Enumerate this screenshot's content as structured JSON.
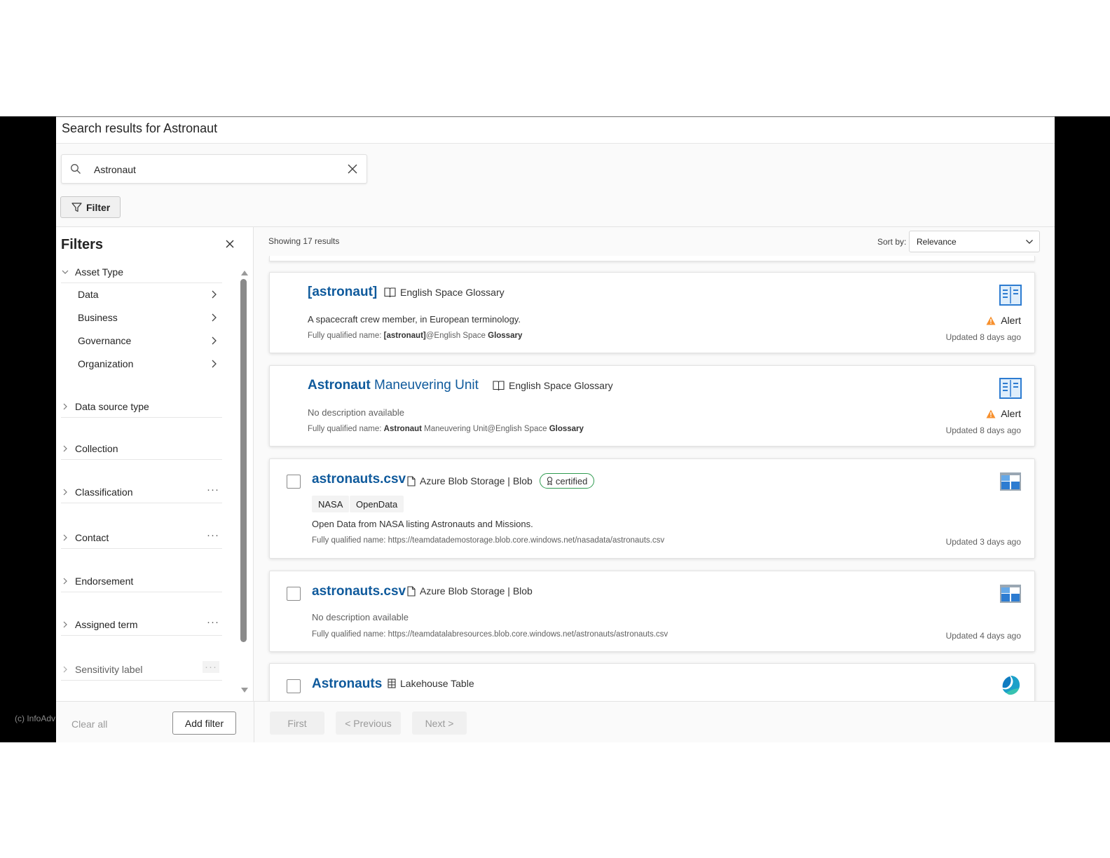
{
  "watermark": "(c) InfoAdv",
  "page": {
    "title": "Search results for Astronaut"
  },
  "search": {
    "value": "Astronaut",
    "placeholder": "Search"
  },
  "filter_button": {
    "label": "Filter"
  },
  "filters": {
    "heading": "Filters",
    "asset_type": {
      "label": "Asset Type",
      "items": [
        "Data",
        "Business",
        "Governance",
        "Organization"
      ]
    },
    "sections": [
      {
        "label": "Data source type",
        "more": false
      },
      {
        "label": "Collection",
        "more": false
      },
      {
        "label": "Classification",
        "more": true
      },
      {
        "label": "Contact",
        "more": true
      },
      {
        "label": "Endorsement",
        "more": false
      },
      {
        "label": "Assigned term",
        "more": true
      },
      {
        "label": "Sensitivity label",
        "more": true
      }
    ],
    "clear_all": "Clear all",
    "add_filter": "Add filter"
  },
  "results": {
    "count_text": "Showing 17 results",
    "sort_label": "Sort by:",
    "sort_value": "Relevance",
    "items": [
      {
        "title": "[astronaut]",
        "type_icon": "book-icon",
        "type_label": "English Space Glossary",
        "description": "A spacecraft crew member, in European terminology.",
        "fqn_prefix": "Fully qualified name: ",
        "fqn_bold1": "[astronaut]",
        "fqn_mid": "@English Space ",
        "fqn_bold2": "Glossary",
        "alert": "Alert",
        "updated": "Updated 8 days ago",
        "asset_icon": "glossary-icon"
      },
      {
        "title_bold": "Astronaut",
        "title_rest": " Maneuvering Unit",
        "type_icon": "book-icon",
        "type_label": "English Space Glossary",
        "description": "No description available",
        "fqn_prefix": "Fully qualified name: ",
        "fqn_bold1": "Astronaut",
        "fqn_mid": " Maneuvering Unit@English Space ",
        "fqn_bold2": "Glossary",
        "alert": "Alert",
        "updated": "Updated 8 days ago",
        "asset_icon": "glossary-icon"
      },
      {
        "title": "astronauts.csv",
        "type_icon": "file-icon",
        "type_label": "Azure Blob Storage | Blob",
        "badge": "certified",
        "tags": [
          "NASA",
          "OpenData"
        ],
        "description": "Open Data from NASA listing Astronauts and Missions.",
        "fqn": "Fully qualified name: https://teamdatademostorage.blob.core.windows.net/nasadata/astronauts.csv",
        "updated": "Updated 3 days ago",
        "asset_icon": "blob-storage-icon"
      },
      {
        "title": "astronauts.csv",
        "type_icon": "file-icon",
        "type_label": "Azure Blob Storage | Blob",
        "description": "No description available",
        "fqn": "Fully qualified name: https://teamdatalabresources.blob.core.windows.net/astronauts/astronauts.csv",
        "updated": "Updated 4 days ago",
        "asset_icon": "blob-storage-icon"
      },
      {
        "title": "Astronauts",
        "type_icon": "table-icon",
        "type_label": "Lakehouse Table",
        "asset_icon": "fabric-icon"
      }
    ]
  },
  "pagination": {
    "first": "First",
    "previous": "< Previous",
    "next": "Next >"
  },
  "colors": {
    "link": "#0f5a9c",
    "alert": "#f7902d",
    "certified": "#2e9b4f",
    "icon_blue": "#2d7cd1"
  }
}
